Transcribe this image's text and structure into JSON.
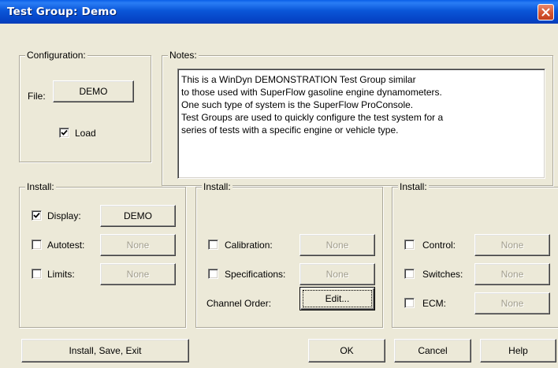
{
  "window": {
    "title": "Test Group:  Demo"
  },
  "configuration": {
    "label": "Configuration:",
    "file_label": "File:",
    "file_button": "DEMO",
    "load_label": "Load",
    "load_checked": true
  },
  "notes": {
    "label": "Notes:",
    "lines": [
      "This is a WinDyn DEMONSTRATION Test Group similar",
      "to those used with SuperFlow gasoline engine dynamometers.",
      "One such type of system is the SuperFlow ProConsole.",
      "Test Groups are used to quickly configure the test system for a",
      "series of tests with a specific engine or vehicle type."
    ]
  },
  "install_left": {
    "label": "Install:",
    "display": {
      "label": "Display:",
      "checked": true,
      "button": "DEMO"
    },
    "autotest": {
      "label": "Autotest:",
      "checked": false,
      "button": "None"
    },
    "limits": {
      "label": "Limits:",
      "checked": false,
      "button": "None"
    }
  },
  "install_mid": {
    "label": "Install:",
    "calibration": {
      "label": "Calibration:",
      "checked": false,
      "button": "None"
    },
    "specifications": {
      "label": "Specifications:",
      "checked": false,
      "button": "None"
    },
    "channel_order": {
      "label": "Channel Order:",
      "button": "Edit..."
    }
  },
  "install_right": {
    "label": "Install:",
    "control": {
      "label": "Control:",
      "checked": false,
      "button": "None"
    },
    "switches": {
      "label": "Switches:",
      "checked": false,
      "button": "None"
    },
    "ecm": {
      "label": "ECM:",
      "checked": false,
      "button": "None"
    }
  },
  "buttons": {
    "install_save_exit": "Install, Save, Exit",
    "ok": "OK",
    "cancel": "Cancel",
    "help": "Help"
  }
}
